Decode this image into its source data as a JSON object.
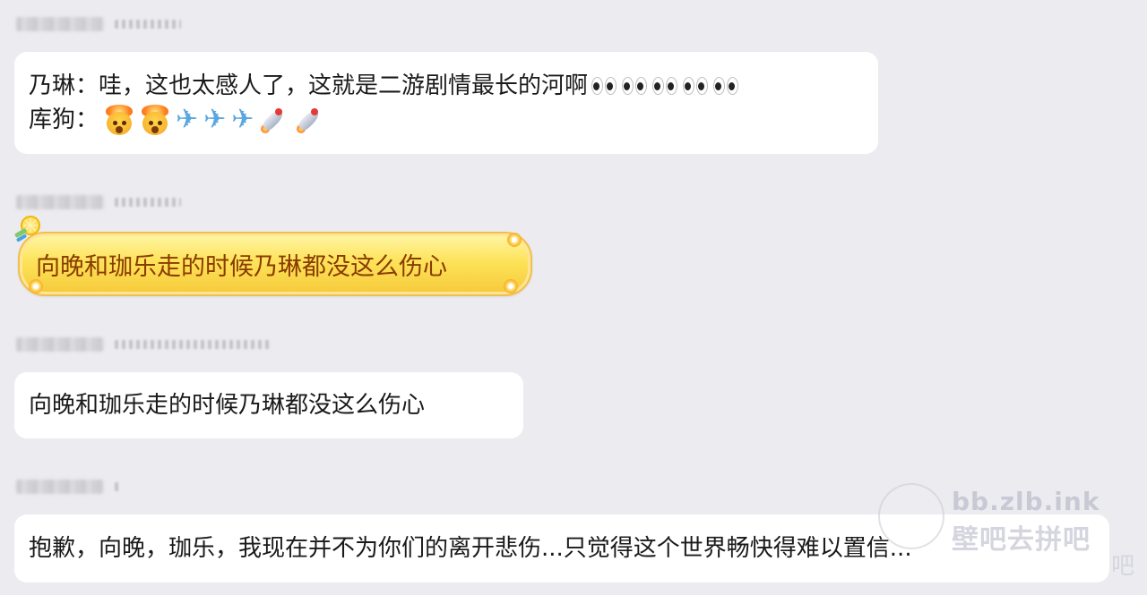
{
  "messages": [
    {
      "lines": [
        {
          "text": "乃琳：哇，这也太感人了，这就是二游剧情最长的河啊",
          "emoji": [
            "eyes-icon",
            "eyes-icon",
            "eyes-icon",
            "eyes-icon",
            "eyes-icon"
          ]
        },
        {
          "text": "库狗：",
          "emoji": [
            "exploding-head-icon",
            "exploding-head-icon",
            "airplane-icon",
            "airplane-icon",
            "airplane-icon",
            "rocket-icon",
            "rocket-icon"
          ]
        }
      ]
    },
    {
      "lines": [
        {
          "text": "向晚和珈乐走的时候乃琳都没这么伤心"
        }
      ],
      "style": "yellow-decorated"
    },
    {
      "lines": [
        {
          "text": "向晚和珈乐走的时候乃琳都没这么伤心"
        }
      ]
    },
    {
      "lines": [
        {
          "text": "抱歉，向晚，珈乐，我现在并不为你们的离开悲伤...只觉得这个世界畅快得难以置信..."
        }
      ]
    }
  ],
  "watermark": {
    "url": "bb.zlb.ink",
    "name": "壁吧去拼吧",
    "edge": "吧"
  },
  "colors": {
    "background": "#ebebf0",
    "bubble": "#ffffff",
    "fancy_bubble": "#fde35a",
    "fancy_text": "#8a3b00"
  }
}
